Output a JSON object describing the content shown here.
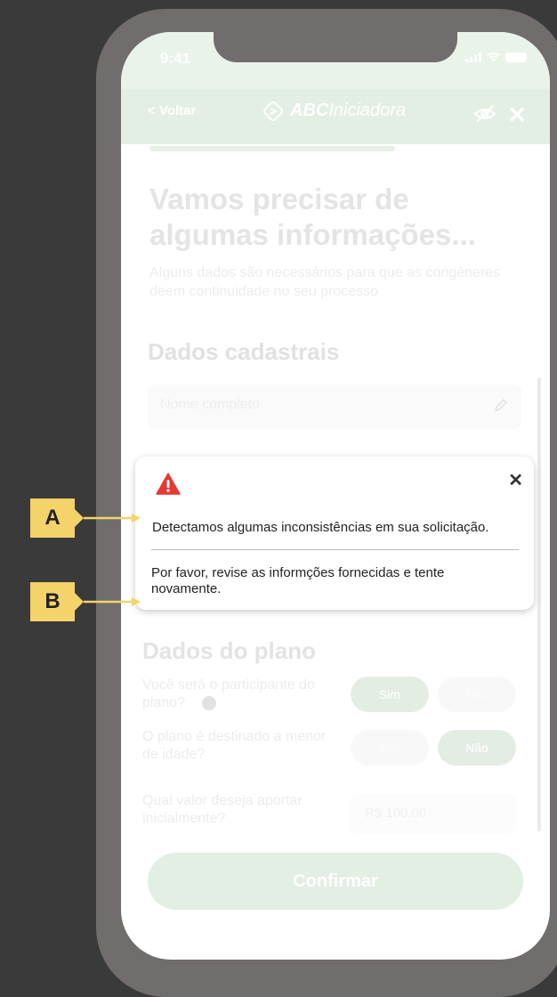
{
  "status": {
    "time": "9:41"
  },
  "header": {
    "back_label": "< Voltar",
    "brand_bold": "ABC",
    "brand_rest": "Iniciadora"
  },
  "form": {
    "title": "Vamos precisar de algumas informações...",
    "subtitle": "Alguns dados são necessários para que as congêneres deem continuidade no seu processo",
    "section_personal": "Dados cadastrais",
    "name_placeholder": "Nome completo",
    "section_plan": "Dados do plano",
    "q_participant": "Você será o participante do plano?",
    "q_minor": "O plano é destinado a menor de idade?",
    "q_amount": "Qual valor deseja aportar inicialmente?",
    "yes_label": "Sim",
    "no_label": "Não",
    "amount_value": "R$ 100,00",
    "confirm_label": "Confirmar"
  },
  "alert": {
    "message_1": "Detectamos algumas inconsistências em sua solicitação.",
    "message_2": "Por favor, revise as informções fornecidas e tente novamente.",
    "close_glyph": "✕"
  },
  "callouts": {
    "a": "A",
    "b": "B"
  },
  "colors": {
    "accent_yellow": "#f4d36b",
    "alert_red": "#e53935",
    "brand_green_light": "#e3efe4"
  },
  "icons": [
    "signal-icon",
    "wifi-icon",
    "battery-icon",
    "brand-logo-icon",
    "eye-off-icon",
    "close-icon",
    "pencil-icon",
    "info-icon",
    "warning-icon"
  ]
}
